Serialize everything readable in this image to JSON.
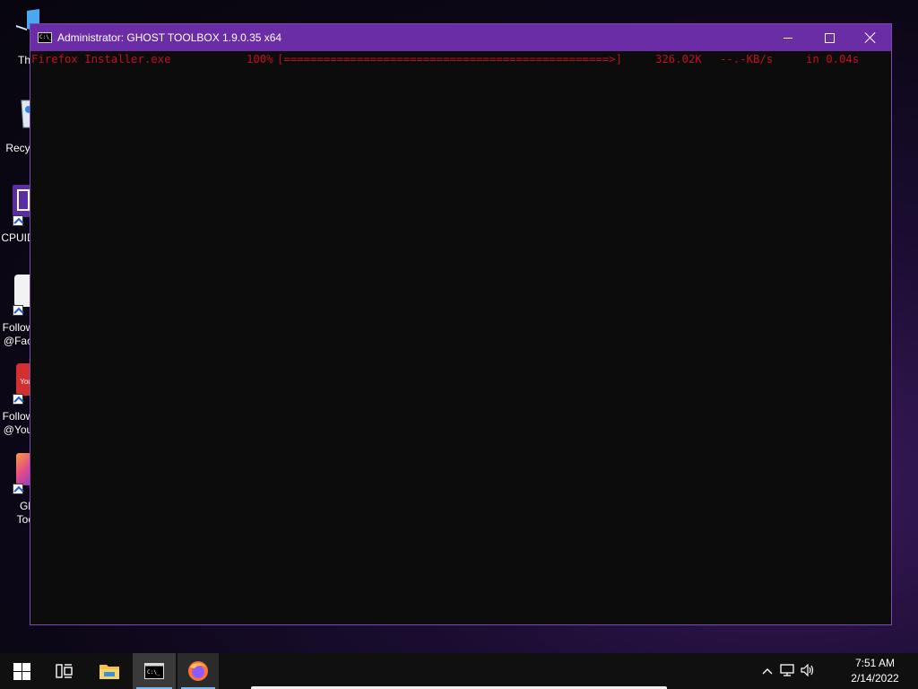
{
  "desktop": {
    "icons": [
      {
        "label_lines": [
          "Th"
        ],
        "icon": "this-pc-icon",
        "shortcut": false
      },
      {
        "label_lines": [
          "Recy"
        ],
        "icon": "recycle-bin-icon",
        "shortcut": false
      },
      {
        "label_lines": [
          "CPUID"
        ],
        "icon": "cpuid-icon",
        "shortcut": true
      },
      {
        "label_lines": [
          "Follow",
          "@Fac"
        ],
        "icon": "facebook-shortcut-icon",
        "shortcut": true
      },
      {
        "label_lines": [
          "Follow",
          "@You"
        ],
        "icon": "youtube-shortcut-icon",
        "shortcut": true
      },
      {
        "label_lines": [
          "Gl",
          "Too"
        ],
        "icon": "ghost-toolbox-shortcut-icon",
        "shortcut": true
      }
    ]
  },
  "window": {
    "title": "Administrator:  GHOST TOOLBOX 1.9.0.35 x64",
    "app_icon_text": "C:\\_",
    "controls": {
      "minimize": "minimize-icon",
      "maximize": "maximize-icon",
      "close": "close-icon"
    },
    "console": {
      "text_color": "#c50f1f",
      "background": "#0c0c0c",
      "line": {
        "file": "Firefox Installer.exe",
        "percent": "100%",
        "bar": "[=================================================>]",
        "size": "326.02K",
        "speed": "--.-KB/s",
        "time": "in 0.04s"
      }
    }
  },
  "taskbar": {
    "buttons": [
      {
        "name": "start-button",
        "icon": "windows-logo-icon"
      },
      {
        "name": "task-view-button",
        "icon": "task-view-icon"
      },
      {
        "name": "file-explorer-button",
        "icon": "folder-icon"
      },
      {
        "name": "command-prompt-button",
        "icon": "command-prompt-icon",
        "state": "active"
      },
      {
        "name": "firefox-button",
        "icon": "firefox-icon",
        "state": "running"
      }
    ],
    "tray": {
      "icons": [
        "chevron-up-icon",
        "network-icon",
        "volume-icon"
      ],
      "time": "7:51 AM",
      "date": "2/14/2022"
    },
    "accent": "#76b9ed"
  }
}
